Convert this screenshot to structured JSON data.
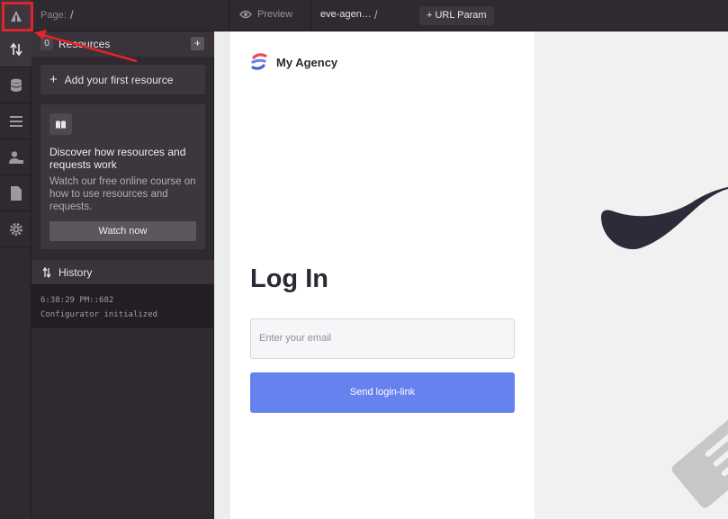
{
  "topbar": {
    "page_label": "Page:",
    "page_value": "/",
    "preview_label": "Preview",
    "app_name": "eve-agen…",
    "app_slash": "/",
    "url_param_label": "+ URL Param"
  },
  "resources": {
    "count": "0",
    "title": "Resources",
    "add_label": "Add your first resource",
    "card_title": "Discover how resources and requests work",
    "card_desc": "Watch our free online course on how to use resources and requests.",
    "watch_label": "Watch now"
  },
  "history": {
    "title": "History",
    "lines": [
      "6:38:29 PM::682",
      "Configurator initialized"
    ]
  },
  "preview_page": {
    "brand": "My Agency",
    "title": "Log In",
    "email_placeholder": "Enter your email",
    "send_label": "Send login-link"
  },
  "colors": {
    "highlight": "#e0242a",
    "primary_button": "#6682ee",
    "dark_shape": "#2d2a3a"
  }
}
